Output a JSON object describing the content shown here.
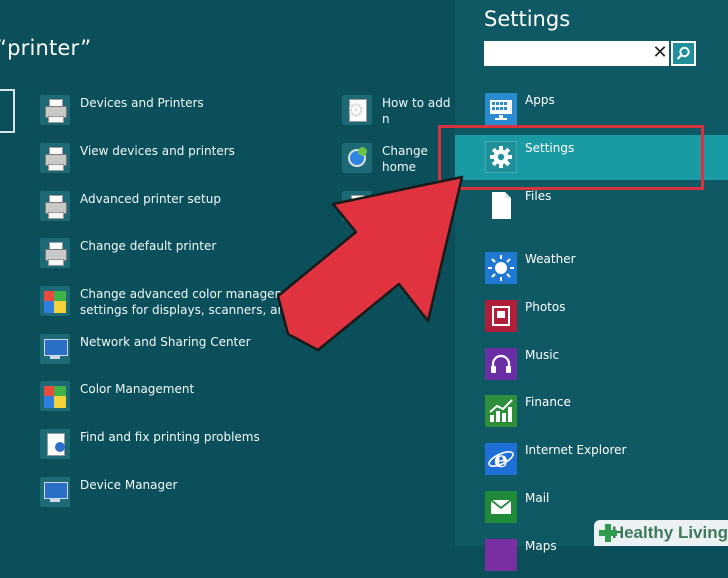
{
  "query": {
    "title": "“printer”"
  },
  "results_left": [
    {
      "label": "Devices and Printers",
      "icon": "printer-icon"
    },
    {
      "label": "View devices and printers",
      "icon": "printer-icon"
    },
    {
      "label": "Advanced printer setup",
      "icon": "printer-icon"
    },
    {
      "label": "Change default printer",
      "icon": "printer-icon"
    },
    {
      "label": "Change advanced color management\nsettings for displays, scanners, and prin",
      "icon": "color-management-icon"
    },
    {
      "label": "Network and Sharing Center",
      "icon": "network-icon"
    },
    {
      "label": "Color Management",
      "icon": "color-management-icon"
    },
    {
      "label": "Find and fix printing problems",
      "icon": "troubleshoot-icon"
    },
    {
      "label": "Device Manager",
      "icon": "device-manager-icon"
    }
  ],
  "results_right": [
    {
      "label": "How to add n",
      "icon": "gear-doc-icon"
    },
    {
      "label": "Change home",
      "icon": "homegroup-icon"
    },
    {
      "label": "•",
      "icon": "printer-icon"
    }
  ],
  "pane": {
    "title": "Settings",
    "search_value": "",
    "clear_icon": "close-icon",
    "search_icon": "search-icon",
    "categories": [
      {
        "label": "Apps",
        "icon": "apps-icon",
        "color": "#2b8bd1"
      },
      {
        "label": "Settings",
        "icon": "gear-icon",
        "color": "#1a9aa2",
        "selected": true
      },
      {
        "label": "Files",
        "icon": "file-icon",
        "color": "#ffffff"
      }
    ],
    "apps": [
      {
        "label": "Weather",
        "icon": "weather-icon",
        "color": "#1f78d1"
      },
      {
        "label": "Photos",
        "icon": "photos-icon",
        "color": "#b01e3a"
      },
      {
        "label": "Music",
        "icon": "music-icon",
        "color": "#6b2fa5"
      },
      {
        "label": "Finance",
        "icon": "finance-icon",
        "color": "#2e8f3b"
      },
      {
        "label": "Internet Explorer",
        "icon": "internet-explorer-icon",
        "color": "#1e6fd6"
      },
      {
        "label": "Mail",
        "icon": "mail-icon",
        "color": "#1e8a3a"
      },
      {
        "label": "Maps",
        "icon": "maps-icon",
        "color": "#7a2fa0"
      }
    ]
  },
  "overlay": {
    "highlight_color": "#d8323f",
    "arrow_color": "#d8323f"
  },
  "watermark": {
    "text": "Healthy Living"
  }
}
